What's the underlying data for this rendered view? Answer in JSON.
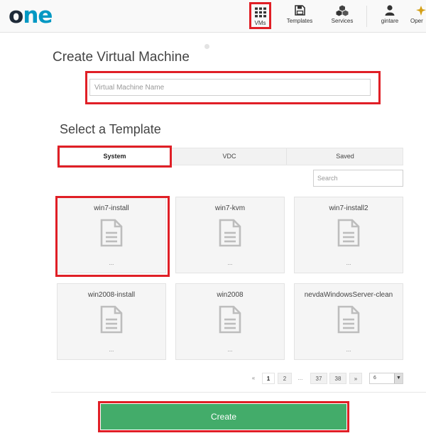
{
  "app": {
    "logo_o": "o",
    "logo_ne": "ne"
  },
  "nav": {
    "items": [
      {
        "label": "VMs",
        "icon": "grid-icon"
      },
      {
        "label": "Templates",
        "icon": "floppy-disk-icon"
      },
      {
        "label": "Services",
        "icon": "cubes-icon"
      },
      {
        "label": "gintare",
        "icon": "user-icon"
      },
      {
        "label": "Oper",
        "icon": "operations-icon"
      }
    ]
  },
  "form": {
    "title": "Create Virtual Machine",
    "name_placeholder": "Virtual Machine Name",
    "name_value": ""
  },
  "templates": {
    "title": "Select a Template",
    "tabs": [
      {
        "label": "System",
        "active": true
      },
      {
        "label": "VDC",
        "active": false
      },
      {
        "label": "Saved",
        "active": false
      }
    ],
    "search_placeholder": "Search",
    "cards": [
      {
        "name": "win7-install",
        "icon": "document-icon",
        "description": "..."
      },
      {
        "name": "win7-kvm",
        "icon": "document-icon",
        "description": "..."
      },
      {
        "name": "win7-install2",
        "icon": "document-icon",
        "description": "..."
      },
      {
        "name": "win2008-install",
        "icon": "document-icon",
        "description": "..."
      },
      {
        "name": "win2008",
        "icon": "document-icon",
        "description": "..."
      },
      {
        "name": "nevdaWindowsServer-clean",
        "icon": "document-icon",
        "description": "..."
      }
    ]
  },
  "pagination": {
    "prev": "«",
    "pages": [
      "1",
      "2"
    ],
    "ellipsis": "...",
    "last_pages": [
      "37",
      "38"
    ],
    "next": "»",
    "page_size": "6",
    "current_page": 1
  },
  "actions": {
    "create_label": "Create"
  },
  "colors": {
    "accent_red": "#e01f26",
    "create_green": "#43ac6a",
    "logo_blue": "#0098c3"
  }
}
